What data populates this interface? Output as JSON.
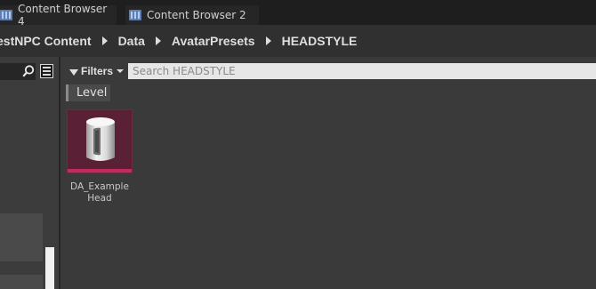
{
  "tabs": [
    {
      "label": "Content Browser 4",
      "icon": "content-browser-icon"
    },
    {
      "label": "Content Browser 2",
      "icon": "content-browser-icon"
    }
  ],
  "breadcrumb": [
    "estNPC Content",
    "Data",
    "AvatarPresets",
    "HEADSTYLE"
  ],
  "toolbar": {
    "filters_label": "Filters"
  },
  "search": {
    "placeholder": "Search HEADSTYLE",
    "value": ""
  },
  "filter_chip": {
    "label": "Level"
  },
  "assets": [
    {
      "line1": "DA_Example",
      "line2": "Head",
      "icon": "data-asset-icon",
      "accent": "#c42a5b"
    }
  ],
  "colors": {
    "background": "#3a3a3a",
    "tab_strip": "#1e1e1e",
    "asset_tile": "#5a2036",
    "asset_stripe": "#c42a5b"
  }
}
